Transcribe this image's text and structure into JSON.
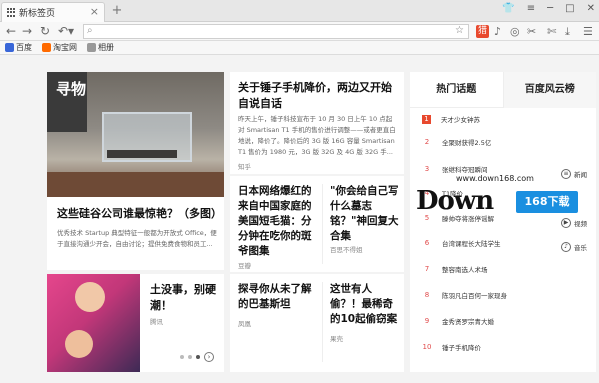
{
  "tabbar": {
    "tab_title": "新标签页",
    "new_tab": "+"
  },
  "toolbar": {
    "back": "←",
    "forward": "→",
    "refresh": "↻",
    "undo": "↶▾",
    "red_icon_label": "猎",
    "menu": "☰"
  },
  "bookmarks": [
    {
      "label": "百度",
      "color": "#3866d8"
    },
    {
      "label": "淘宝网",
      "color": "#ff6a00"
    },
    {
      "label": "相册",
      "color": "#999999"
    }
  ],
  "feature": {
    "magazine_label": "寻物",
    "title": "这些硅谷公司谁最惊艳？（多图）",
    "desc": "优秀技术 Startup 典型特征一般都为开放式 Office，便于直接沟通少开会，自由讨论；提供免费食物和员工..."
  },
  "mini": {
    "title": "土没事，别硬潮！",
    "source": "腾讯"
  },
  "article_main": {
    "title": "关于锤子手机降价，两边又开始自说自话",
    "body": "昨天上午，锤子科技宣布于 10 月 30 日上午 10 点起对 Smartisan T1 手机的售价进行调整——或者更直白地说，降价了。降价后的 3G 版 16G 容量 Smartisan T1 售价为 1980 元，3G 版 32G 及 4G 版 32G 手..."
  },
  "articles": [
    {
      "title": "日本网络爆红的来自中国家庭的美国短毛猫：分分钟在吃你的斑爷图集",
      "source": "豆瓣"
    },
    {
      "title": "\"你会给自己写什么墓志铭？\"神回复大合集",
      "source": "百思不得姐"
    },
    {
      "title": "探寻你从未了解的巴基斯坦",
      "source": "凤凰"
    },
    {
      "title": "这世有人偷？！最稀奇的10起偷窃案",
      "source": "果壳"
    }
  ],
  "source_top": "知乎",
  "hot": {
    "tab_active": "热门话题",
    "tab_other": "百度风云榜",
    "items": [
      {
        "no": "1",
        "text": "天才少女钟苏"
      },
      {
        "no": "2",
        "text": "全聚财获得2.5亿"
      },
      {
        "no": "3",
        "text": "张继科夺冠瞬间"
      },
      {
        "no": "4",
        "text": "T1降价"
      },
      {
        "no": "5",
        "text": "滕帅夺将涨停谣解"
      },
      {
        "no": "6",
        "text": "台湾课程长大陆学生"
      },
      {
        "no": "7",
        "text": "整容南选人术场"
      },
      {
        "no": "8",
        "text": "陈羽凡白百何一家现身"
      },
      {
        "no": "9",
        "text": "金秀贤罗宗青大婚"
      },
      {
        "no": "10",
        "text": "锤子手机降价"
      }
    ]
  },
  "side": [
    {
      "label": "新闻"
    },
    {
      "label": "视频"
    },
    {
      "label": "音乐"
    }
  ],
  "watermark": {
    "logo": "Down",
    "badge": "168下载",
    "url": "www.down168.com"
  }
}
